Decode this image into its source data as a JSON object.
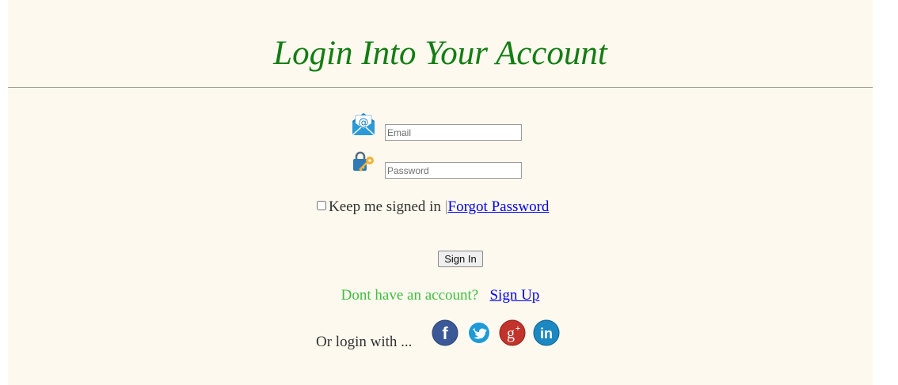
{
  "header": {
    "title": "Login Into Your Account"
  },
  "form": {
    "email_placeholder": "Email",
    "password_placeholder": "Password",
    "keep_signed_in_label": "Keep me signed in",
    "separator": "|",
    "forgot_password_label": "Forgot Password",
    "sign_in_label": "Sign In",
    "no_account_text": "Dont have an account?",
    "sign_up_label": "Sign Up",
    "social_label": "Or login with ..."
  },
  "social": [
    {
      "name": "facebook",
      "glyph": "f",
      "color": "#3b5998"
    },
    {
      "name": "twitter",
      "glyph": "",
      "color": "#1f9ad6"
    },
    {
      "name": "google-plus",
      "glyph": "g+",
      "color": "#c1332b"
    },
    {
      "name": "linkedin",
      "glyph": "in",
      "color": "#1b88c2"
    }
  ],
  "colors": {
    "title": "#137d13",
    "background": "#fdf9ee",
    "link": "#0000ee",
    "prompt": "#3fbf3f"
  }
}
